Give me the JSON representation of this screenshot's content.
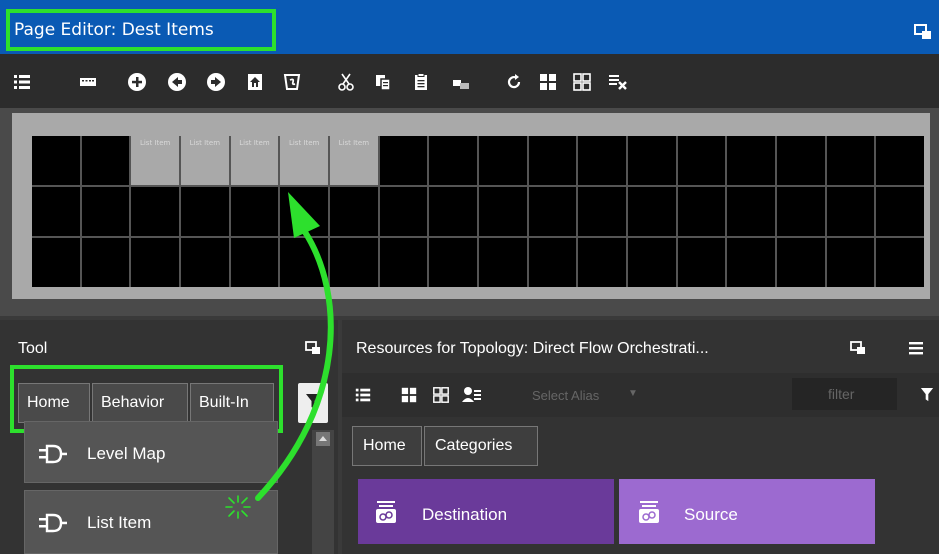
{
  "title_bar": {
    "title": "Page Editor: Dest Items"
  },
  "grid": {
    "rows": 3,
    "columns": 18,
    "list_items": [
      {
        "row": 1,
        "col": 3,
        "label": "List Item"
      },
      {
        "row": 1,
        "col": 4,
        "label": "List Item"
      },
      {
        "row": 1,
        "col": 5,
        "label": "List Item"
      },
      {
        "row": 1,
        "col": 6,
        "label": "List Item"
      },
      {
        "row": 1,
        "col": 7,
        "label": "List Item"
      }
    ]
  },
  "tool_panel": {
    "title": "Tool",
    "breadcrumb": [
      "Home",
      "Behavior",
      "Built-In"
    ],
    "items": [
      {
        "label": "Level Map",
        "icon": "behavior-connector-icon"
      },
      {
        "label": "List Item",
        "icon": "behavior-connector-icon"
      }
    ]
  },
  "resources_panel": {
    "title": "Resources for Topology: Direct Flow Orchestrati...",
    "alias_placeholder": "Select Alias",
    "filter_placeholder": "filter",
    "breadcrumb": [
      "Home",
      "Categories"
    ],
    "categories": [
      {
        "label": "Destination",
        "color": "#6a3a9a"
      },
      {
        "label": "Source",
        "color": "#9c6ad0"
      }
    ]
  },
  "colors": {
    "title_bar": "#0a5ab4",
    "highlight": "#2de02d",
    "arrow": "#2de02d"
  }
}
